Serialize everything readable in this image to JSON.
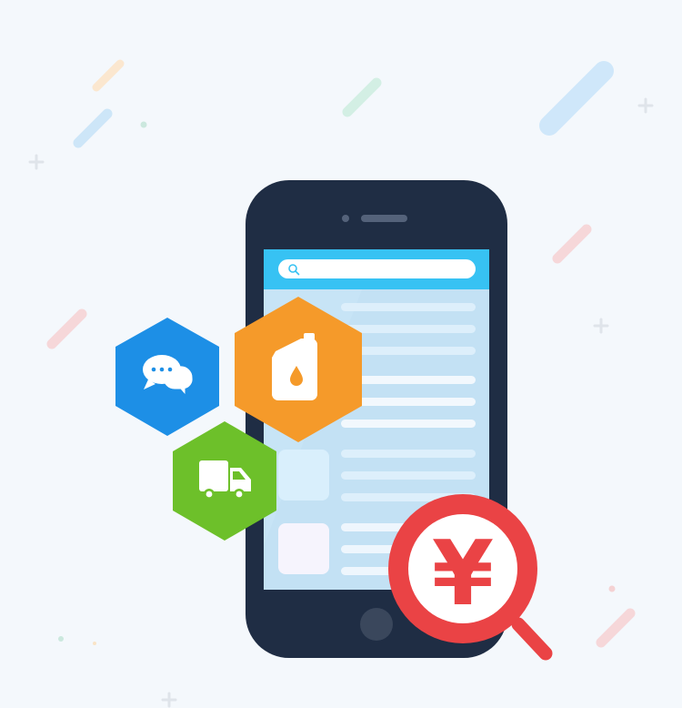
{
  "illustration": {
    "colors": {
      "background": "#f4f8fc",
      "phone_body": "#1f2d44",
      "screen_bg": "#c7e4f6",
      "search_bar": "#37c2f3",
      "chat_hex": "#1d8fe6",
      "oil_hex": "#f59a2a",
      "truck_hex": "#6dc02a",
      "magnifier": "#ea4345"
    },
    "currency_symbol": "¥",
    "icons": [
      "search-icon",
      "chat-bubbles-icon",
      "oil-can-icon",
      "delivery-truck-icon",
      "yen-magnifier-icon"
    ]
  }
}
